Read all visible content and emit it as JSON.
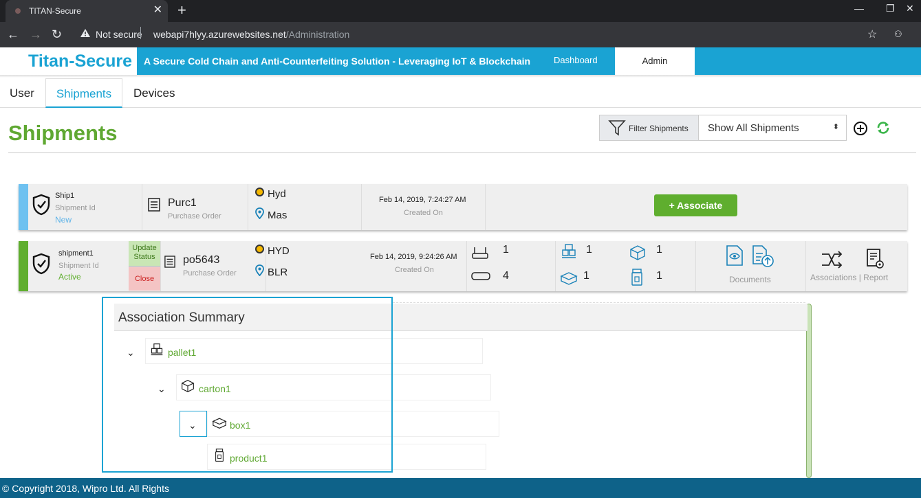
{
  "browser": {
    "tab_title": "TITAN-Secure",
    "security": "Not secure",
    "url_host": "webapi7hlyy.azurewebsites.net",
    "url_path": "/Administration"
  },
  "header": {
    "brand": "Titan-Secure",
    "tagline": "A Secure Cold Chain and Anti-Counterfeiting Solution - Leveraging IoT & Blockchain",
    "nav": [
      "Dashboard",
      "Admin"
    ]
  },
  "tabs": [
    "User",
    "Shipments",
    "Devices"
  ],
  "page": {
    "title": "Shipments",
    "filter_label": "Filter Shipments",
    "filter_value": "Show All Shipments"
  },
  "shipments": [
    {
      "name": "Ship1",
      "id_label": "Shipment Id",
      "status": "New",
      "po": "Purc1",
      "po_label": "Purchase Order",
      "from": "Hyd",
      "to": "Mas",
      "created": "Feb 14, 2019, 7:24:27 AM",
      "created_label": "Created On",
      "associate_label": "+ Associate",
      "colors": {
        "strip": "#6ec1f0",
        "status": "#5db3e8"
      }
    },
    {
      "name": "shipment1",
      "id_label": "Shipment Id",
      "status": "Active",
      "update_label": "Update Status",
      "close_label": "Close",
      "po": "po5643",
      "po_label": "Purchase Order",
      "from": "HYD",
      "to": "BLR",
      "created": "Feb 14, 2019, 9:24:26 AM",
      "created_label": "Created On",
      "counts": {
        "gateway": "1",
        "tag": "4",
        "pallet": "1",
        "carton": "1",
        "box": "1",
        "product": "1"
      },
      "documents_label": "Documents",
      "associations_label": "Associations | Report",
      "colors": {
        "strip": "#5fae2e",
        "status": "#5fae2e"
      }
    }
  ],
  "summary": {
    "title": "Association Summary",
    "tree": [
      {
        "name": "pallet1",
        "icon": "pallet-icon"
      },
      {
        "name": "carton1",
        "icon": "carton-icon"
      },
      {
        "name": "box1",
        "icon": "box-icon"
      },
      {
        "name": "product1",
        "icon": "product-icon"
      }
    ]
  },
  "footer": "© Copyright 2018, Wipro Ltd. All Rights"
}
